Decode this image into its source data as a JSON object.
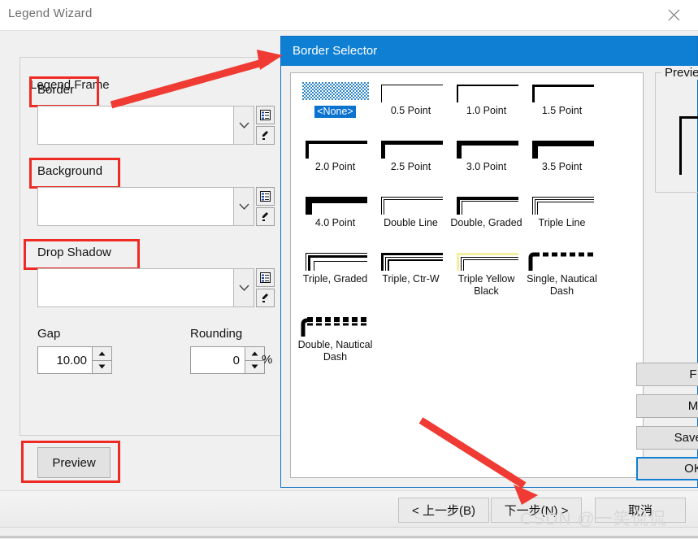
{
  "wizard": {
    "title": "Legend Wizard",
    "close_icon": "close-icon",
    "group_legend": "Legend Frame",
    "fields": {
      "border_label": "Border",
      "background_label": "Background",
      "drop_shadow_label": "Drop Shadow",
      "border_value": "",
      "background_value": "",
      "drop_shadow_value": ""
    },
    "gap": {
      "label": "Gap",
      "value": "10.00"
    },
    "rounding": {
      "label": "Rounding",
      "value": "0",
      "unit": "%"
    },
    "preview_button": "Preview",
    "footer": {
      "back": "< 上一步(B)",
      "next": "下一步(N) >",
      "cancel": "取消"
    },
    "watermark": "CSDN @一笑侃侃"
  },
  "border_selector": {
    "title": "Border Selector",
    "preview_label": "Preview",
    "selected_index": 0,
    "samples": [
      {
        "label": "<None>",
        "style": "none"
      },
      {
        "label": "0.5 Point",
        "style": "solid",
        "weight": 1
      },
      {
        "label": "1.0 Point",
        "style": "solid",
        "weight": 2
      },
      {
        "label": "1.5 Point",
        "style": "solid",
        "weight": 3
      },
      {
        "label": "2.0 Point",
        "style": "solid",
        "weight": 4
      },
      {
        "label": "2.5 Point",
        "style": "solid",
        "weight": 5
      },
      {
        "label": "3.0 Point",
        "style": "solid",
        "weight": 6
      },
      {
        "label": "3.5 Point",
        "style": "solid",
        "weight": 7
      },
      {
        "label": "4.0 Point",
        "style": "solid",
        "weight": 8
      },
      {
        "label": "Double Line",
        "style": "double"
      },
      {
        "label": "Double, Graded",
        "style": "double-graded"
      },
      {
        "label": "Triple Line",
        "style": "triple"
      },
      {
        "label": "Triple, Graded",
        "style": "triple-graded"
      },
      {
        "label": "Triple, Ctr-W",
        "style": "triple-ctrw"
      },
      {
        "label": "Triple Yellow Black",
        "style": "triple-yellow-black"
      },
      {
        "label": "Single, Nautical Dash",
        "style": "single-nautical"
      },
      {
        "label": "Double, Nautical Dash",
        "style": "double-nautical"
      }
    ],
    "buttons": [
      {
        "name": "first-button",
        "label": "F"
      },
      {
        "name": "second-button",
        "label": "M"
      },
      {
        "name": "save-button",
        "label": "Save..."
      },
      {
        "name": "ok-button",
        "label": "OK"
      }
    ]
  },
  "annotations": {
    "arrow_1": "arrow-to-border-selector",
    "arrow_2": "arrow-to-next-button",
    "highlight_color": "#ee2a24"
  }
}
